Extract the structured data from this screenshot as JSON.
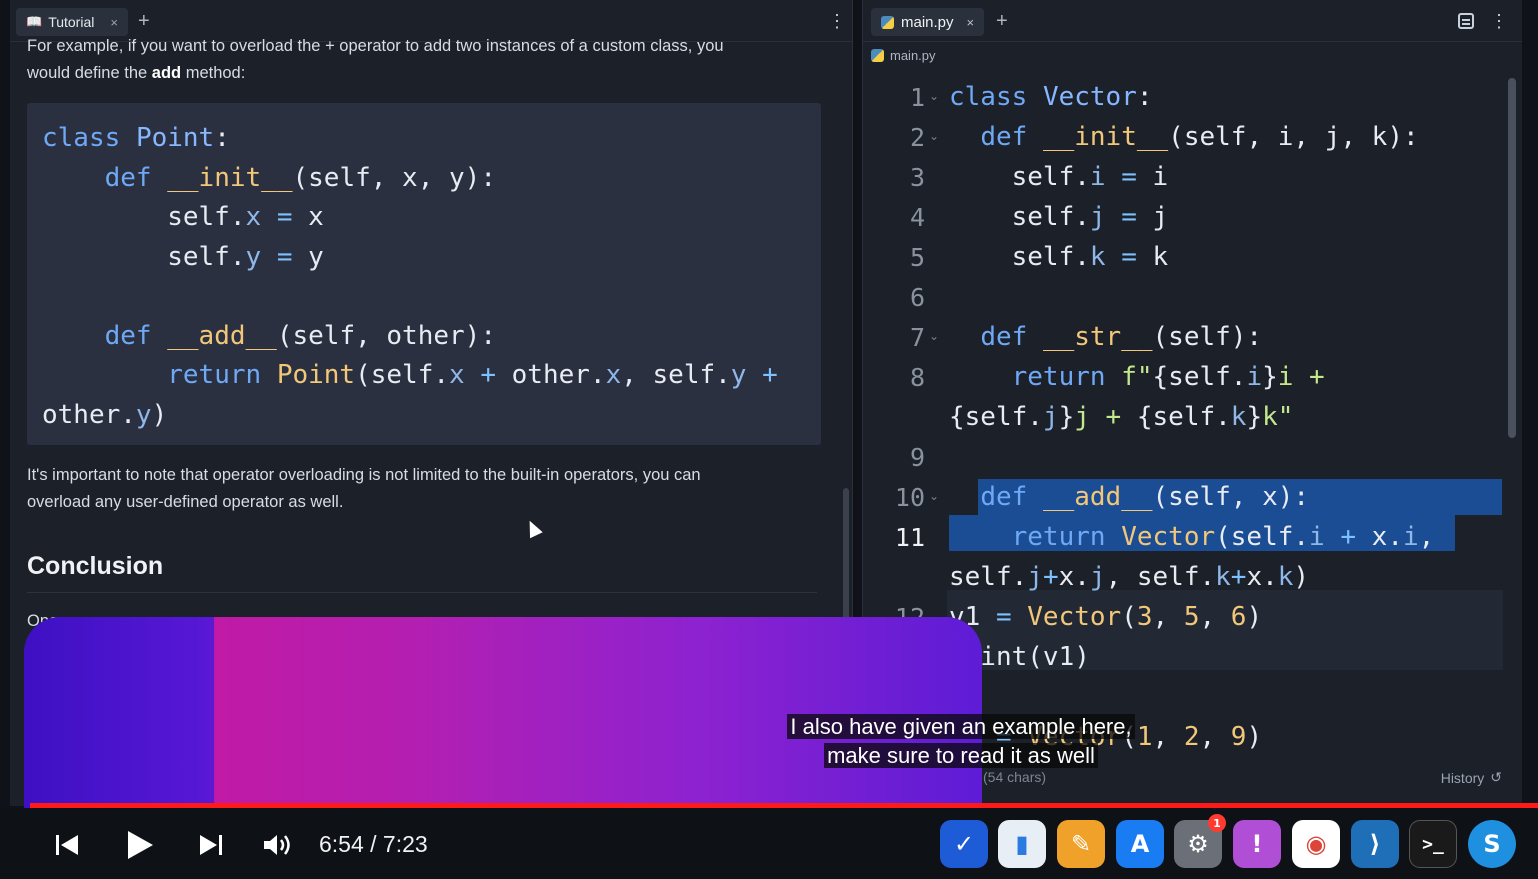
{
  "left": {
    "tab_label": "Tutorial",
    "tab_close": "×",
    "new_tab": "+",
    "menu": "⋮",
    "intro_line1": "For example, if you want to overload the + operator to add two instances of a custom class, you",
    "intro_line2_pre": "would define the ",
    "intro_line2_bold": "add",
    "intro_line2_post": " method:",
    "note_line1": "It's important to note that operator overloading is not limited to the built-in operators, you can",
    "note_line2": "overload any user-defined operator as well.",
    "heading": "Conclusion",
    "partial_text": "Ope"
  },
  "right": {
    "tab_label": "main.py",
    "tab_close": "×",
    "new_tab": "+",
    "breadcrumb": "main.py",
    "chars_count": "(54 chars)",
    "history_label": "History",
    "line_numbers": [
      "1",
      "2",
      "3",
      "4",
      "5",
      "6",
      "7",
      "8",
      "9",
      "10",
      "11",
      "12"
    ]
  },
  "caption": {
    "line1": "I also have given an example here,",
    "line2": "make sure to read it as well"
  },
  "player": {
    "time": "6:54 / 7:23",
    "progress_fraction": 0.957
  },
  "colors": {
    "accent_red": "#ff1a1a",
    "selection": "#1a4d94",
    "keyword": "#6fa8f5"
  }
}
